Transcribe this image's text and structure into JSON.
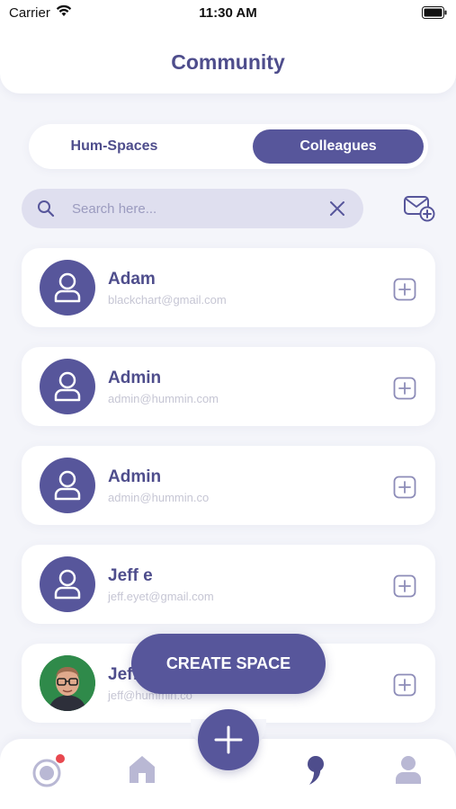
{
  "status_bar": {
    "carrier": "Carrier",
    "time": "11:30 AM"
  },
  "header": {
    "title": "Community"
  },
  "tabs": [
    {
      "label": "Hum-Spaces",
      "active": false
    },
    {
      "label": "Colleagues",
      "active": true
    }
  ],
  "search": {
    "placeholder": "Search here...",
    "value": ""
  },
  "contacts": [
    {
      "name": "Adam",
      "email": "blackchart@gmail.com",
      "avatar": "default-user-icon"
    },
    {
      "name": "Admin",
      "email": "admin@hummin.com",
      "avatar": "default-user-icon"
    },
    {
      "name": "Admin",
      "email": "admin@hummin.co",
      "avatar": "default-user-icon"
    },
    {
      "name": "Jeff e",
      "email": "jeff.eyet@gmail.com",
      "avatar": "default-user-icon"
    },
    {
      "name": "Jeff",
      "email": "jeff@hummin.co",
      "avatar": "photo"
    }
  ],
  "create_space": {
    "label": "CREATE SPACE"
  },
  "bottom_nav": [
    {
      "name": "activity",
      "icon": "activity-icon",
      "has_notification": true
    },
    {
      "name": "home",
      "icon": "home-icon"
    },
    {
      "name": "add",
      "icon": "plus-icon"
    },
    {
      "name": "community",
      "icon": "comma-icon"
    },
    {
      "name": "profile",
      "icon": "profile-icon"
    }
  ],
  "colors": {
    "accent": "#57569b",
    "text": "#4e4d8c",
    "background": "#f4f5fa",
    "notification": "#e8484f"
  }
}
